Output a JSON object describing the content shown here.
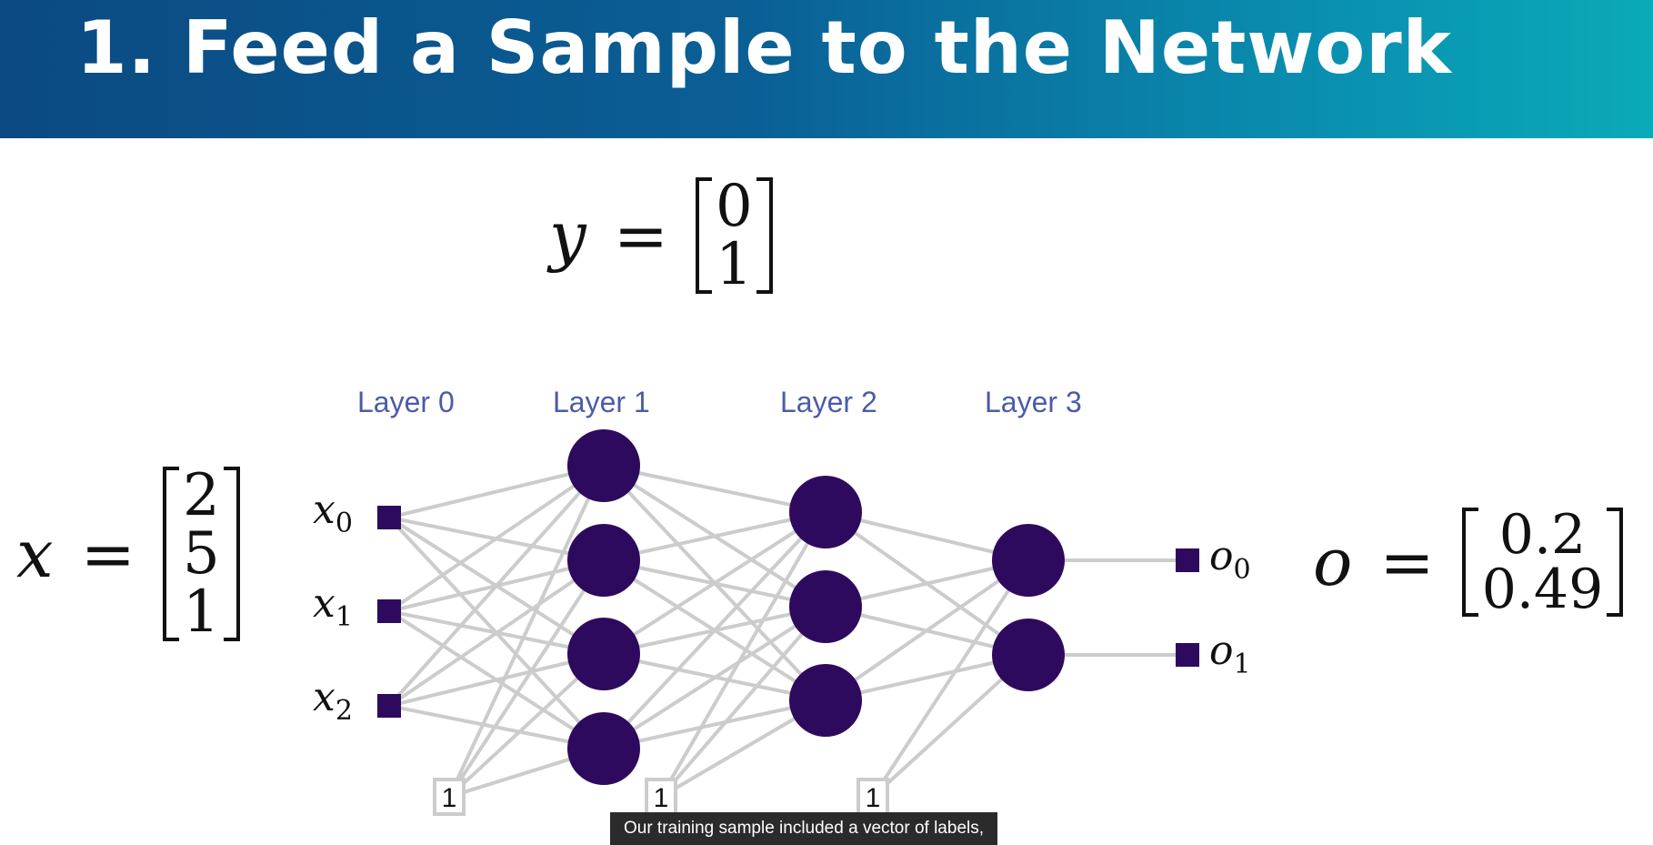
{
  "slide": {
    "title": "1. Feed a Sample to the Network"
  },
  "equations": {
    "y": {
      "symbol": "y",
      "values": [
        "0",
        "1"
      ]
    },
    "x": {
      "symbol": "x",
      "values": [
        "2",
        "5",
        "1"
      ]
    },
    "o": {
      "symbol": "o",
      "values": [
        "0.2",
        "0.49"
      ]
    },
    "equals": "="
  },
  "network": {
    "layers": [
      {
        "label": "Layer 0",
        "nodes": 3
      },
      {
        "label": "Layer 1",
        "nodes": 4
      },
      {
        "label": "Layer 2",
        "nodes": 3
      },
      {
        "label": "Layer 3",
        "nodes": 2
      }
    ],
    "input_labels": [
      {
        "base": "x",
        "sub": "0"
      },
      {
        "base": "x",
        "sub": "1"
      },
      {
        "base": "x",
        "sub": "2"
      }
    ],
    "output_labels": [
      {
        "base": "o",
        "sub": "0"
      },
      {
        "base": "o",
        "sub": "1"
      }
    ],
    "bias_label": "1",
    "colors": {
      "node": "#2e0a5e",
      "edge": "#cccccc",
      "bias_border": "#cccccc",
      "layer_label": "#4b5ba8"
    }
  },
  "caption": "Our training sample included a vector of labels,"
}
